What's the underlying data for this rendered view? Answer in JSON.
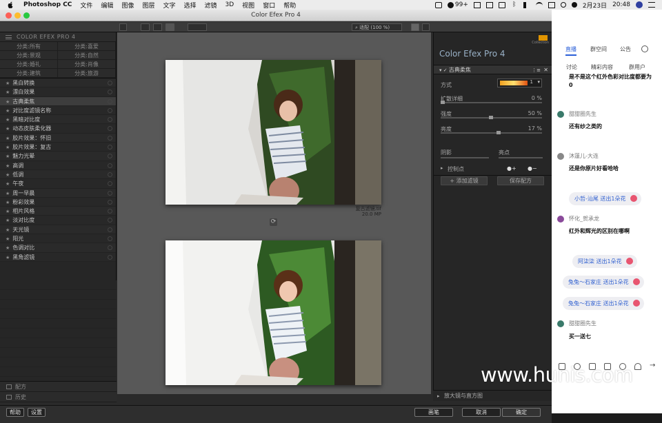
{
  "menubar": {
    "app": "Photoshop CC",
    "items": [
      "文件",
      "编辑",
      "图像",
      "图层",
      "文字",
      "选择",
      "滤镜",
      "3D",
      "视图",
      "窗口",
      "帮助"
    ],
    "badge": "99+",
    "date": "2月23日",
    "time": "20:48"
  },
  "window": {
    "title": "Color Efex Pro 4"
  },
  "toolbar": {
    "zoom": "适配 (100 %)"
  },
  "left_panel": {
    "brand": "COLOR EFEX PRO 4",
    "categories": [
      "分类:所有",
      "分类:喜爱",
      "分类:景观",
      "分类:自然",
      "分类:婚礼",
      "分类:肖像",
      "分类:建筑",
      "分类:旅游"
    ],
    "filters": [
      "黑白转换",
      "漂白效果",
      "古典柔焦",
      "对比度滤镜名称",
      "黑暗对比度",
      "动态皮肤柔化器",
      "胶片效果：怀旧",
      "胶片效果：复古",
      "魅力光晕",
      "高调",
      "低调",
      "午夜",
      "周一早晨",
      "粉彩效果",
      "相片风格",
      "淡对比度",
      "天光镜",
      "阳光",
      "色调对比",
      "黑角滤镜"
    ],
    "footer": [
      "配方",
      "历史"
    ]
  },
  "center": {
    "caption_file": "复古滤镜.tif",
    "caption_size": "20.0 MP"
  },
  "right_panel": {
    "title": "Color Efex Pro",
    "version": "4",
    "logo": "Collection",
    "filter_name": "古典柔焦",
    "method_label": "方式",
    "method_value": "1",
    "params": [
      {
        "label": "扩散详细",
        "value": "0 %",
        "level": 0
      },
      {
        "label": "强度",
        "value": "50 %",
        "level": 50
      },
      {
        "label": "亮度",
        "value": "17 %",
        "level": 17
      }
    ],
    "shadow_label": "阴影",
    "highlight_label": "亮点",
    "control_points": "控制点",
    "add_filter": "添加滤镜",
    "save_recipe": "保存配方",
    "bottom": "放大镜与直方图"
  },
  "statusbar": {
    "help": "帮助",
    "settings": "设置",
    "brush": "画笔",
    "cancel": "取消",
    "ok": "确定"
  },
  "chat": {
    "tabs": [
      "直播",
      "群空间",
      "公告"
    ],
    "subtabs": [
      "讨论",
      "精彩内容",
      "群用户"
    ],
    "messages": [
      {
        "text": "是不是这个红外色彩对比度都要为0"
      },
      {
        "name": "甜甜圈先生",
        "text": "还有纱之类的"
      },
      {
        "name": "沐蓮儿-大连",
        "text": "还是你原片好看哈哈"
      },
      {
        "gift": "小哲-汕尾 送出1朵花"
      },
      {
        "name": "怀化_贺承龙",
        "text": "红外和辉光的区别在哪啊"
      },
      {
        "gift": "阿柒柒 送出1朵花"
      },
      {
        "gift": "兔兔～石家庄 送出1朵花"
      },
      {
        "gift": "兔兔～石家庄 送出1朵花"
      },
      {
        "name": "甜甜圈先生",
        "text": "买一送七"
      }
    ]
  },
  "watermark": "www.hunis.com"
}
